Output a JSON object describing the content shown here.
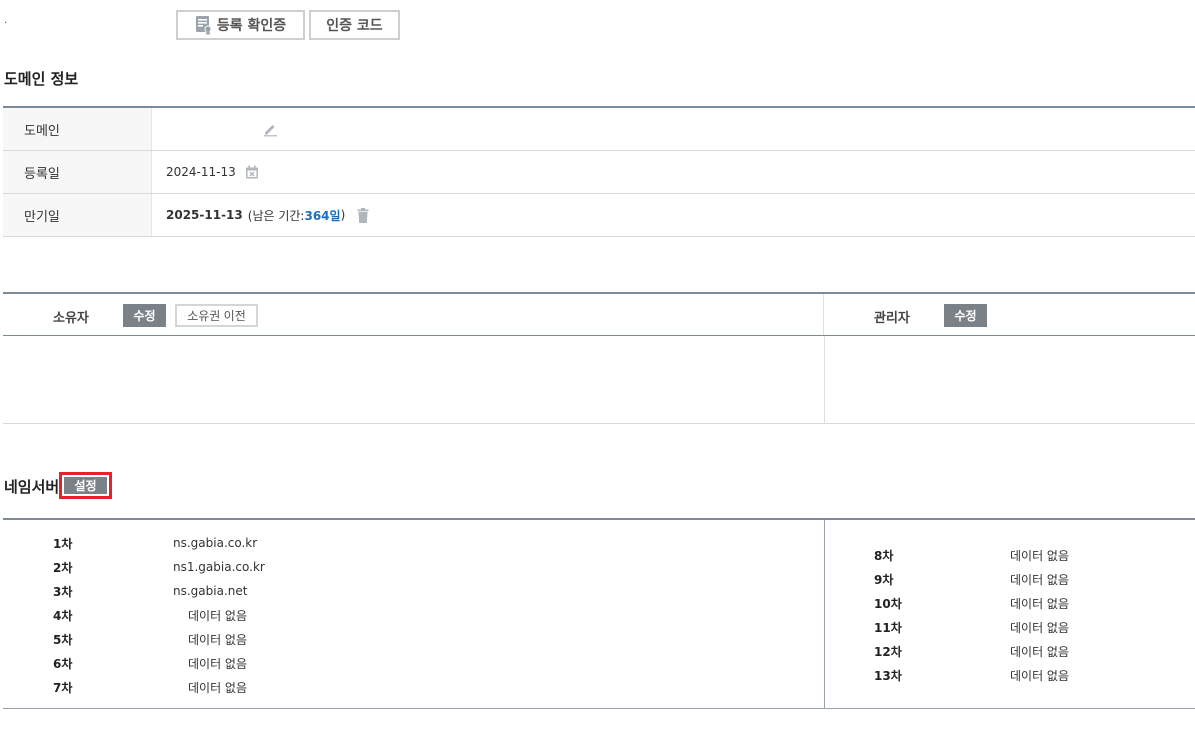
{
  "top": {
    "dot": "·",
    "cert_button": "등록 확인증",
    "code_button": "인증 코드"
  },
  "domain_info": {
    "title": "도메인 정보",
    "rows": [
      {
        "label": "도메인",
        "value": ""
      },
      {
        "label": "등록일",
        "value": "2024-11-13"
      },
      {
        "label": "만기일",
        "value": "2025-11-13",
        "remain_prefix": "(남은 기간: ",
        "remain_days": "364일",
        "remain_suffix": " )"
      }
    ]
  },
  "contacts": {
    "owner_label": "소유자",
    "owner_edit": "수정",
    "owner_transfer": "소유권 이전",
    "admin_label": "관리자",
    "admin_edit": "수정"
  },
  "nameserver": {
    "title": "네임서버",
    "set_button": "설정",
    "left": [
      {
        "order": "1차",
        "value": "ns.gabia.co.kr"
      },
      {
        "order": "2차",
        "value": "ns1.gabia.co.kr"
      },
      {
        "order": "3차",
        "value": "ns.gabia.net"
      },
      {
        "order": "4차",
        "value": "데이터 없음"
      },
      {
        "order": "5차",
        "value": "데이터 없음"
      },
      {
        "order": "6차",
        "value": "데이터 없음"
      },
      {
        "order": "7차",
        "value": "데이터 없음"
      }
    ],
    "right": [
      {
        "order": "8차",
        "value": "데이터 없음"
      },
      {
        "order": "9차",
        "value": "데이터 없음"
      },
      {
        "order": "10차",
        "value": "데이터 없음"
      },
      {
        "order": "11차",
        "value": "데이터 없음"
      },
      {
        "order": "12차",
        "value": "데이터 없음"
      },
      {
        "order": "13차",
        "value": "데이터 없음"
      }
    ]
  },
  "icons": {
    "cert": "certificate-icon",
    "edit": "pencil-icon",
    "calendar": "calendar-icon",
    "trash": "trash-icon"
  },
  "colors": {
    "accent_blue": "#1a6fc0",
    "button_gray": "#7a8288",
    "highlight_red": "#e0242b",
    "table_border": "#7d8b99"
  }
}
